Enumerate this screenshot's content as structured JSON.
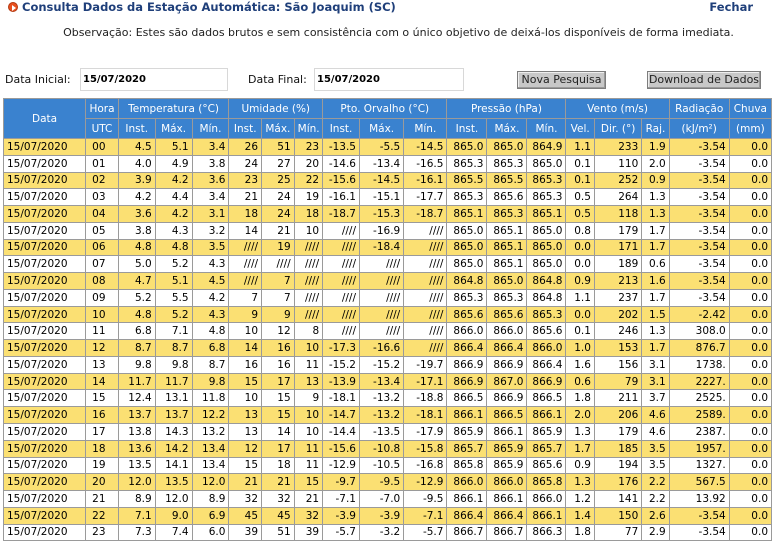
{
  "header": {
    "title": "Consulta Dados da Estação Automática: São Joaquim (SC)",
    "close_label": "Fechar",
    "note": "Observação: Estes são dados brutos e sem consistência com o único objetivo de deixá-los disponíveis de forma imediata."
  },
  "filters": {
    "start_label": "Data Inicial:",
    "start_value": "15/07/2020",
    "end_label": "Data Final:",
    "end_value": "15/07/2020",
    "search_button": "Nova Pesquisa",
    "download_button": "Download de Dados"
  },
  "table": {
    "groups": [
      "Data",
      "Hora",
      "Temperatura (°C)",
      "Umidade (%)",
      "Pto. Orvalho (°C)",
      "Pressão (hPa)",
      "Vento (m/s)",
      "Radiação",
      "Chuva"
    ],
    "subheaders": [
      "UTC",
      "Inst.",
      "Máx.",
      "Mín.",
      "Inst.",
      "Máx.",
      "Mín.",
      "Inst.",
      "Máx.",
      "Mín.",
      "Inst.",
      "Máx.",
      "Mín.",
      "Vel.",
      "Dir. (°)",
      "Raj.",
      "(kJ/m²)",
      "(mm)"
    ],
    "rows": [
      [
        "15/07/2020",
        "00",
        "4.5",
        "5.1",
        "3.4",
        "26",
        "51",
        "23",
        "-13.5",
        "-5.5",
        "-14.5",
        "865.0",
        "865.0",
        "864.9",
        "1.1",
        "233",
        "1.9",
        "-3.54",
        "0.0"
      ],
      [
        "15/07/2020",
        "01",
        "4.0",
        "4.9",
        "3.8",
        "24",
        "27",
        "20",
        "-14.6",
        "-13.4",
        "-16.5",
        "865.3",
        "865.3",
        "865.0",
        "0.1",
        "110",
        "2.0",
        "-3.54",
        "0.0"
      ],
      [
        "15/07/2020",
        "02",
        "3.9",
        "4.2",
        "3.6",
        "23",
        "25",
        "22",
        "-15.6",
        "-14.5",
        "-16.1",
        "865.5",
        "865.5",
        "865.3",
        "0.1",
        "252",
        "0.9",
        "-3.54",
        "0.0"
      ],
      [
        "15/07/2020",
        "03",
        "4.2",
        "4.4",
        "3.4",
        "21",
        "24",
        "19",
        "-16.1",
        "-15.1",
        "-17.7",
        "865.3",
        "865.6",
        "865.3",
        "0.5",
        "264",
        "1.3",
        "-3.54",
        "0.0"
      ],
      [
        "15/07/2020",
        "04",
        "3.6",
        "4.2",
        "3.1",
        "18",
        "24",
        "18",
        "-18.7",
        "-15.3",
        "-18.7",
        "865.1",
        "865.3",
        "865.1",
        "0.5",
        "118",
        "1.3",
        "-3.54",
        "0.0"
      ],
      [
        "15/07/2020",
        "05",
        "3.8",
        "4.3",
        "3.2",
        "14",
        "21",
        "10",
        "////",
        "-16.9",
        "////",
        "865.0",
        "865.1",
        "865.0",
        "0.8",
        "179",
        "1.7",
        "-3.54",
        "0.0"
      ],
      [
        "15/07/2020",
        "06",
        "4.8",
        "4.8",
        "3.5",
        "////",
        "19",
        "////",
        "////",
        "-18.4",
        "////",
        "865.0",
        "865.1",
        "865.0",
        "0.0",
        "171",
        "1.7",
        "-3.54",
        "0.0"
      ],
      [
        "15/07/2020",
        "07",
        "5.0",
        "5.2",
        "4.3",
        "////",
        "////",
        "////",
        "////",
        "////",
        "////",
        "865.0",
        "865.1",
        "865.0",
        "0.0",
        "189",
        "0.6",
        "-3.54",
        "0.0"
      ],
      [
        "15/07/2020",
        "08",
        "4.7",
        "5.1",
        "4.5",
        "////",
        "7",
        "////",
        "////",
        "////",
        "////",
        "864.8",
        "865.0",
        "864.8",
        "0.9",
        "213",
        "1.6",
        "-3.54",
        "0.0"
      ],
      [
        "15/07/2020",
        "09",
        "5.2",
        "5.5",
        "4.2",
        "7",
        "7",
        "////",
        "////",
        "////",
        "////",
        "865.3",
        "865.3",
        "864.8",
        "1.1",
        "237",
        "1.7",
        "-3.54",
        "0.0"
      ],
      [
        "15/07/2020",
        "10",
        "4.8",
        "5.2",
        "4.3",
        "9",
        "9",
        "////",
        "////",
        "////",
        "////",
        "865.6",
        "865.6",
        "865.3",
        "0.0",
        "202",
        "1.5",
        "-2.42",
        "0.0"
      ],
      [
        "15/07/2020",
        "11",
        "6.8",
        "7.1",
        "4.8",
        "10",
        "12",
        "8",
        "////",
        "////",
        "////",
        "866.0",
        "866.0",
        "865.6",
        "0.1",
        "246",
        "1.3",
        "308.0",
        "0.0"
      ],
      [
        "15/07/2020",
        "12",
        "8.7",
        "8.7",
        "6.8",
        "14",
        "16",
        "10",
        "-17.3",
        "-16.6",
        "////",
        "866.4",
        "866.4",
        "866.0",
        "1.0",
        "153",
        "1.7",
        "876.7",
        "0.0"
      ],
      [
        "15/07/2020",
        "13",
        "9.8",
        "9.8",
        "8.7",
        "16",
        "16",
        "11",
        "-15.2",
        "-15.2",
        "-19.7",
        "866.9",
        "866.9",
        "866.4",
        "1.6",
        "156",
        "3.1",
        "1738.",
        "0.0"
      ],
      [
        "15/07/2020",
        "14",
        "11.7",
        "11.7",
        "9.8",
        "15",
        "17",
        "13",
        "-13.9",
        "-13.4",
        "-17.1",
        "866.9",
        "867.0",
        "866.9",
        "0.6",
        "79",
        "3.1",
        "2227.",
        "0.0"
      ],
      [
        "15/07/2020",
        "15",
        "12.4",
        "13.1",
        "11.8",
        "10",
        "15",
        "9",
        "-18.1",
        "-13.2",
        "-18.8",
        "866.5",
        "866.9",
        "866.5",
        "1.8",
        "211",
        "3.7",
        "2525.",
        "0.0"
      ],
      [
        "15/07/2020",
        "16",
        "13.7",
        "13.7",
        "12.2",
        "13",
        "15",
        "10",
        "-14.7",
        "-13.2",
        "-18.1",
        "866.1",
        "866.5",
        "866.1",
        "2.0",
        "206",
        "4.6",
        "2589.",
        "0.0"
      ],
      [
        "15/07/2020",
        "17",
        "13.8",
        "14.3",
        "13.2",
        "13",
        "14",
        "10",
        "-14.4",
        "-13.5",
        "-17.9",
        "865.9",
        "866.1",
        "865.9",
        "1.3",
        "179",
        "4.6",
        "2387.",
        "0.0"
      ],
      [
        "15/07/2020",
        "18",
        "13.6",
        "14.2",
        "13.4",
        "12",
        "17",
        "11",
        "-15.6",
        "-10.8",
        "-15.8",
        "865.7",
        "865.9",
        "865.7",
        "1.7",
        "185",
        "3.5",
        "1957.",
        "0.0"
      ],
      [
        "15/07/2020",
        "19",
        "13.5",
        "14.1",
        "13.4",
        "15",
        "18",
        "11",
        "-12.9",
        "-10.5",
        "-16.8",
        "865.8",
        "865.9",
        "865.6",
        "0.9",
        "194",
        "3.5",
        "1327.",
        "0.0"
      ],
      [
        "15/07/2020",
        "20",
        "12.0",
        "13.5",
        "12.0",
        "21",
        "21",
        "15",
        "-9.7",
        "-9.5",
        "-12.9",
        "866.0",
        "866.0",
        "865.8",
        "1.3",
        "176",
        "2.2",
        "567.5",
        "0.0"
      ],
      [
        "15/07/2020",
        "21",
        "8.9",
        "12.0",
        "8.9",
        "32",
        "32",
        "21",
        "-7.1",
        "-7.0",
        "-9.5",
        "866.1",
        "866.1",
        "866.0",
        "1.2",
        "141",
        "2.2",
        "13.92",
        "0.0"
      ],
      [
        "15/07/2020",
        "22",
        "7.1",
        "9.0",
        "6.9",
        "45",
        "45",
        "32",
        "-3.9",
        "-3.9",
        "-7.1",
        "866.4",
        "866.4",
        "866.1",
        "1.4",
        "150",
        "2.6",
        "-3.54",
        "0.0"
      ],
      [
        "15/07/2020",
        "23",
        "7.3",
        "7.4",
        "6.0",
        "39",
        "51",
        "39",
        "-5.7",
        "-3.2",
        "-5.7",
        "866.7",
        "866.7",
        "866.3",
        "1.8",
        "77",
        "2.9",
        "-3.54",
        "0.0"
      ]
    ]
  }
}
